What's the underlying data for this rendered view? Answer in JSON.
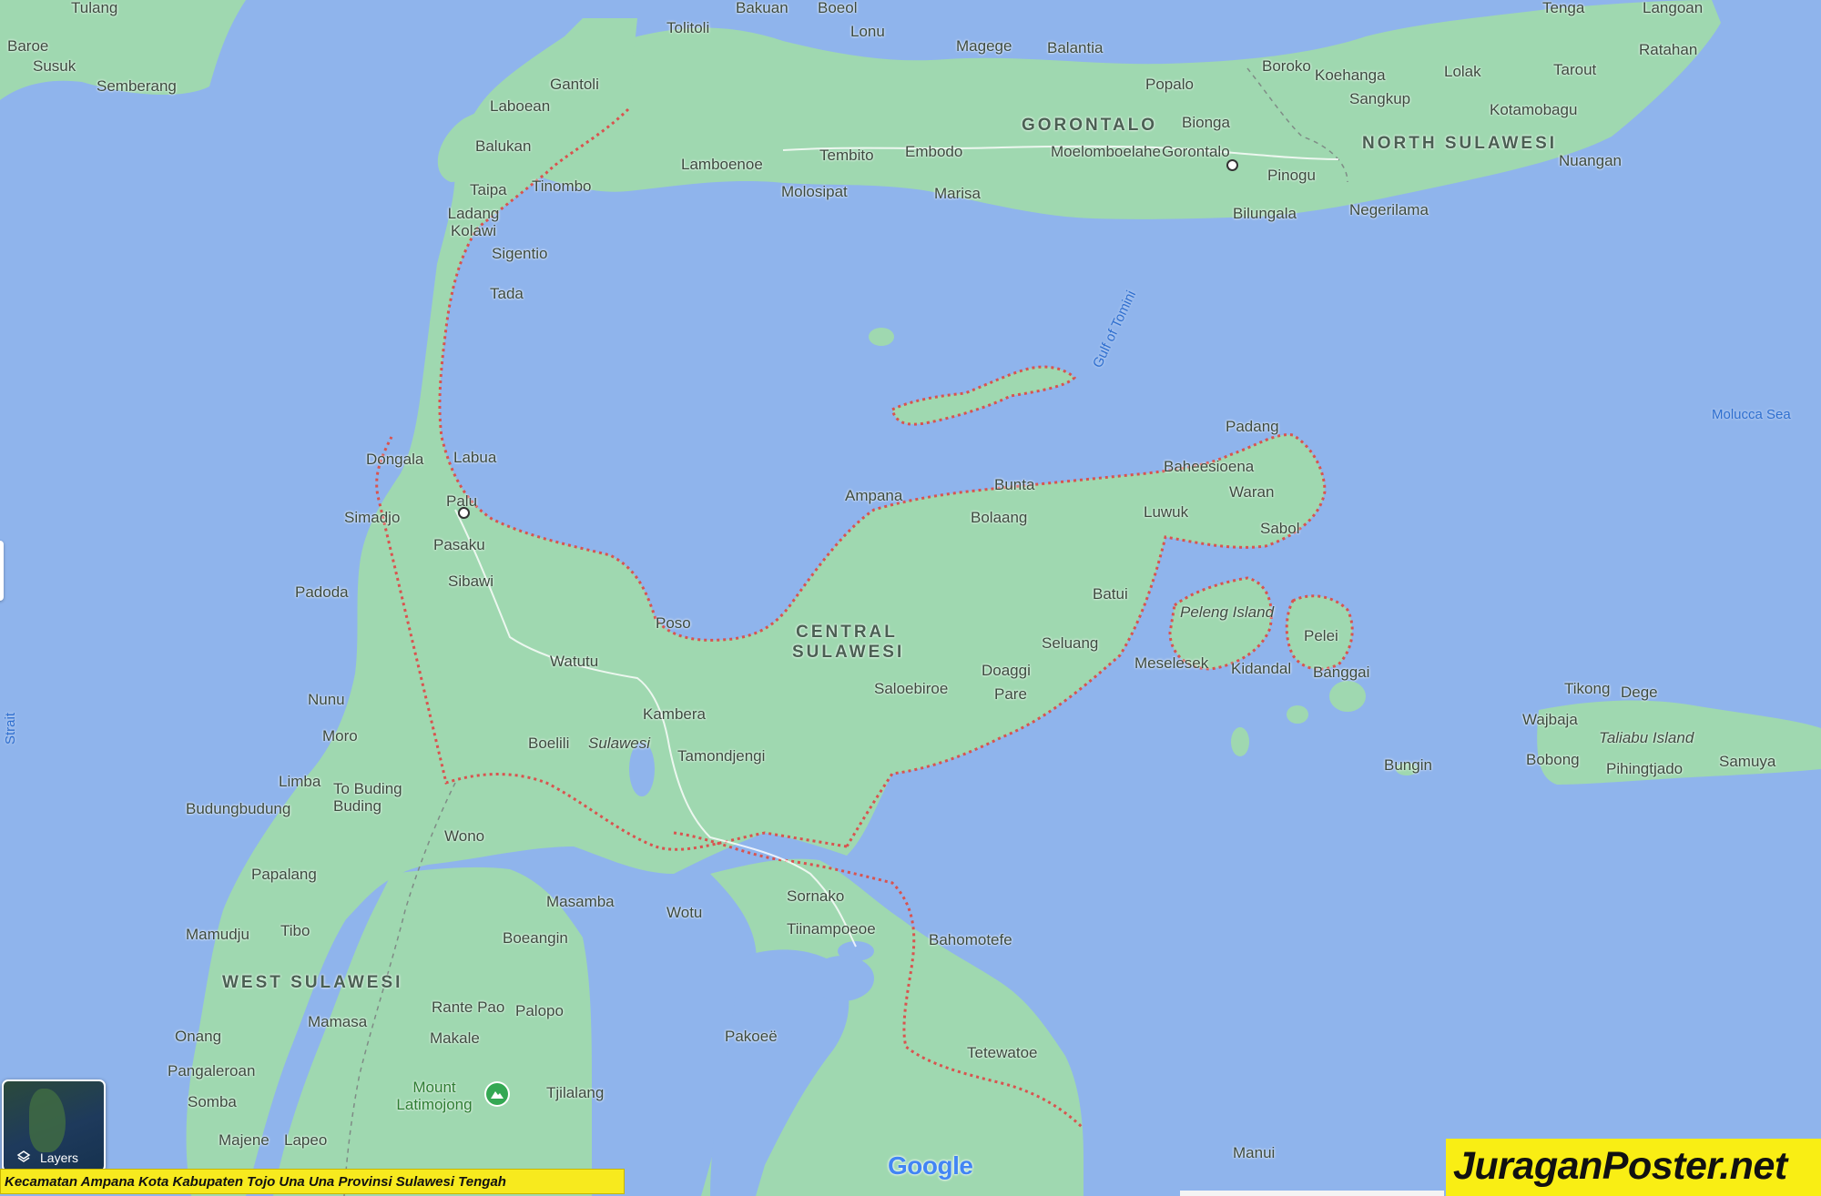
{
  "map": {
    "colors": {
      "water": "#8fb4ec",
      "land": "#9fd8b0",
      "land_dark": "#8cc99e",
      "boundary": "#d9534f",
      "label": "#3c4a3e"
    },
    "regions": [
      {
        "id": "gorontalo",
        "name": "GORONTALO"
      },
      {
        "id": "north-sulawesi",
        "name": "NORTH SULAWESI"
      },
      {
        "id": "central-sulawesi",
        "name": "CENTRAL SULAWESI"
      },
      {
        "id": "west-sulawesi",
        "name": "WEST SULAWESI"
      }
    ],
    "water_labels": [
      "Gulf of Tomini",
      "Molucca Sea",
      "Strait"
    ],
    "places": [
      "Tolitoli",
      "Lonu",
      "Boeol",
      "Bakuan",
      "Magege",
      "Balantia",
      "Gantoli",
      "Laboean",
      "Balukan",
      "Taipa",
      "Tinombo",
      "Lamboenoe",
      "Molosipat",
      "Tembito",
      "Embodo",
      "Marisa",
      "Moelomboelahe",
      "Gorontalo",
      "Bionga",
      "Popalo",
      "Pinogu",
      "Bilungala",
      "Boroko",
      "Koehanga",
      "Sangkup",
      "Lolak",
      "Tarout",
      "Ratahan",
      "Kotamobagu",
      "Nuangan",
      "Negerilama",
      "Langoan",
      "Tenga",
      "Ladang Kolawi",
      "Sigentio",
      "Tada",
      "Dongala",
      "Labua",
      "Palu",
      "Simadjo",
      "Pasaku",
      "Sibawi",
      "Padoda",
      "Ampana",
      "Bunta",
      "Bolaang",
      "Padang",
      "Baheesioena",
      "Luwuk",
      "Waran",
      "Sabol",
      "Batui",
      "Seluang",
      "Doaggi",
      "Pare",
      "Saloebiroe",
      "Poso",
      "Watutu",
      "Kambera",
      "Boelili",
      "Tamondjengi",
      "Peleng Island",
      "Pelei",
      "Meselesek",
      "Kidandal",
      "Banggai",
      "Bungin",
      "Tikong",
      "Dege",
      "Wajbaja",
      "Taliabu Island",
      "Bobong",
      "Pihingtjado",
      "Samuya",
      "Nunu",
      "Moro",
      "Limba",
      "To Buding Buding",
      "Budungbudung",
      "Wono",
      "Papalang",
      "Mamudju",
      "Tibo",
      "Masamba",
      "Boeangin",
      "Wotu",
      "Sornako",
      "Tiinampoeoe",
      "Bahomotefe",
      "Rante Pao",
      "Mamasa",
      "Palopo",
      "Makale",
      "Onang",
      "Pangaleroan",
      "Somba",
      "Majene",
      "Lapeo",
      "Mount Latimojong",
      "Tjilalang",
      "Pakoeë",
      "Tetewatoe",
      "Manui",
      "Baroe",
      "Susuk",
      "Semberang",
      "Sulawesi",
      "Tulang"
    ]
  },
  "controls": {
    "layers_label": "Layers",
    "map_brand": "Google"
  },
  "caption": "Kecamatan Ampana Kota Kabupaten Tojo Una Una Provinsi Sulawesi Tengah",
  "watermark": "JuraganPoster.net"
}
